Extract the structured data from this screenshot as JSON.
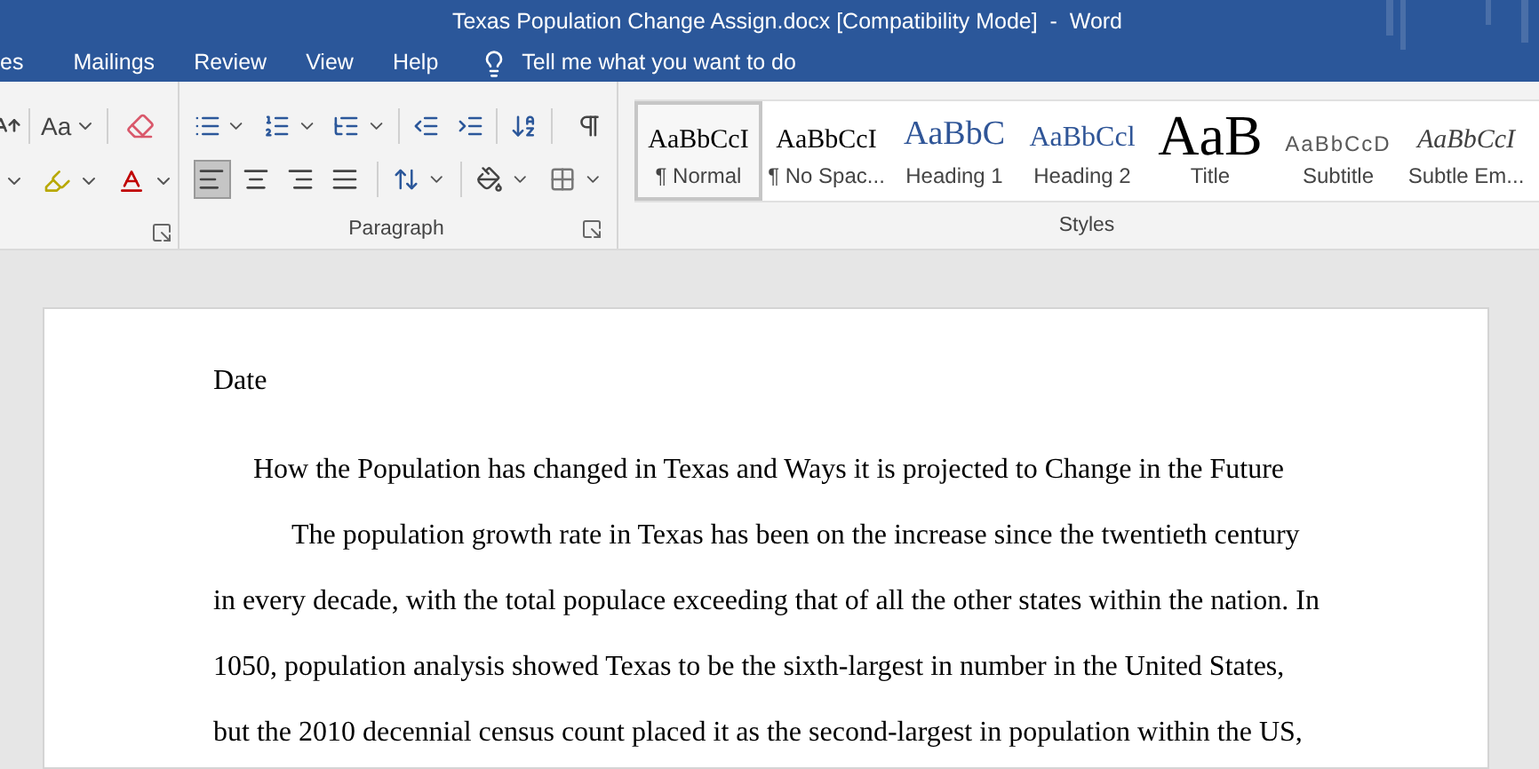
{
  "title_bar": {
    "title": "Texas Population Change Assign.docx [Compatibility Mode]  -  Word"
  },
  "menu_tabs": [
    {
      "label": "es"
    },
    {
      "label": "Mailings"
    },
    {
      "label": "Review"
    },
    {
      "label": "View"
    },
    {
      "label": "Help"
    }
  ],
  "tell_me": {
    "label": "Tell me what you want to do"
  },
  "font_group": {
    "change_case": "Aa"
  },
  "paragraph_group": {
    "label": "Paragraph",
    "alignments": [
      {
        "kind": "left",
        "selected": true
      },
      {
        "kind": "center",
        "selected": false
      },
      {
        "kind": "right",
        "selected": false
      },
      {
        "kind": "justify",
        "selected": false
      }
    ]
  },
  "styles_group": {
    "label": "Styles",
    "styles": [
      {
        "kind": "normal",
        "preview": "AaBbCcI",
        "name": "¶ Normal",
        "selected": true
      },
      {
        "kind": "normal",
        "preview": "AaBbCcI",
        "name": "¶ No Spac...",
        "selected": false
      },
      {
        "kind": "heading1",
        "preview": "AaBbC",
        "name": "Heading 1",
        "selected": false
      },
      {
        "kind": "heading2",
        "preview": "AaBbCcl",
        "name": "Heading 2",
        "selected": false
      },
      {
        "kind": "title",
        "preview": "AaB",
        "name": "Title",
        "selected": false
      },
      {
        "kind": "subtitle",
        "preview": "AaBbCcD",
        "name": "Subtitle",
        "selected": false
      },
      {
        "kind": "emphasis",
        "preview": "AaBbCcI",
        "name": "Subtle Em...",
        "selected": false
      }
    ]
  },
  "document": {
    "paragraphs": [
      {
        "kind": "plain",
        "text": "Date"
      },
      {
        "kind": "centered",
        "text": "How the Population has changed in Texas and Ways it is projected to Change in the Future"
      },
      {
        "kind": "indented",
        "text": "The population growth rate in Texas has been on the increase since the twentieth century in every decade, with the total populace exceeding that of all the other states within the nation. In 1050, population analysis showed Texas to be the sixth-largest in number in the United States, but the 2010 decennial census count placed it as the second-largest in population within the US,"
      }
    ]
  }
}
